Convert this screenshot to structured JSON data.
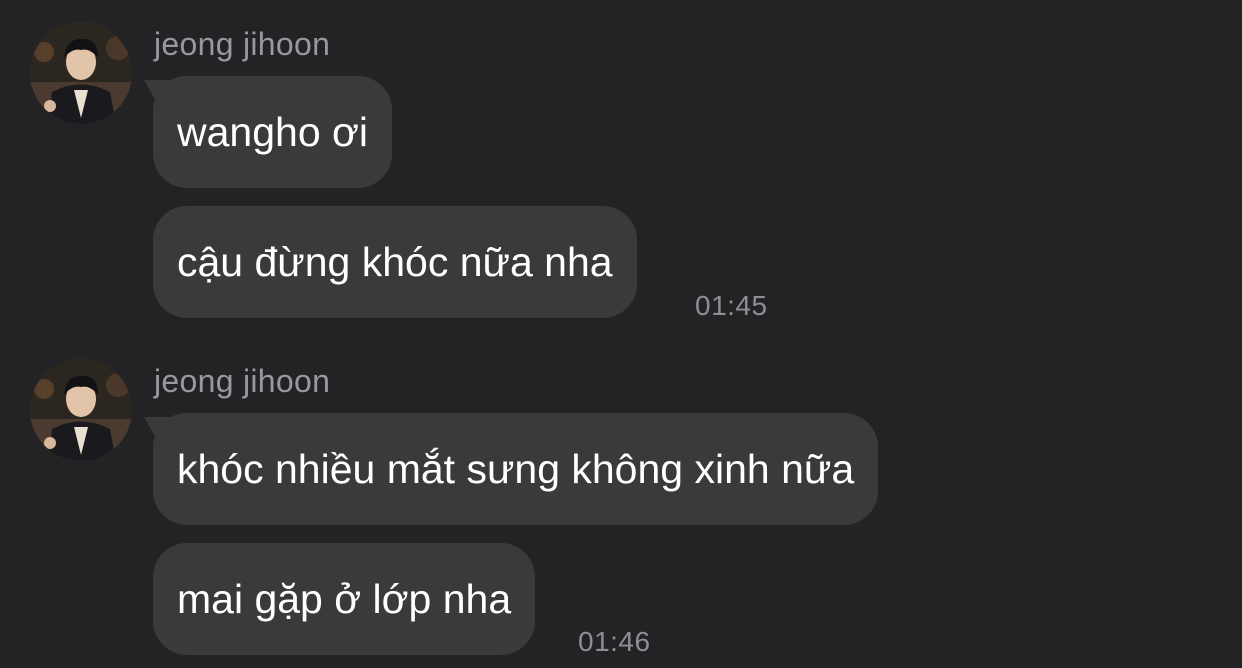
{
  "messages": [
    {
      "sender": "jeong jihoon",
      "bubbles": [
        "wangho ơi",
        "cậu đừng khóc nữa nha"
      ],
      "time": "01:45"
    },
    {
      "sender": "jeong jihoon",
      "bubbles": [
        "khóc nhiều mắt sưng không xinh nữa",
        "mai gặp ở lớp nha"
      ],
      "time": "01:46"
    }
  ],
  "colors": {
    "background": "#232325",
    "bubble": "#3a3a3c",
    "text": "#ffffff",
    "meta": "#98989d"
  },
  "icons": {
    "avatar": "profile-photo-avatar"
  }
}
